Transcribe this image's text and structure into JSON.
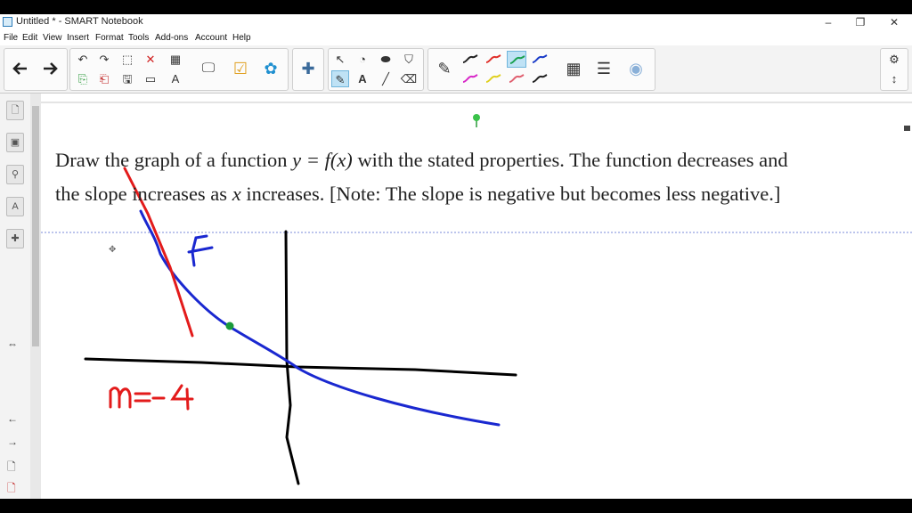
{
  "window": {
    "title": "Untitled * - SMART Notebook",
    "controls": {
      "minimize": "–",
      "maximize": "❐",
      "close": "✕"
    }
  },
  "menu": [
    "File",
    "Edit",
    "View",
    "Insert",
    "Format",
    "Tools",
    "Add-ons",
    "Account",
    "Help"
  ],
  "toolbar": {
    "icons": [
      "back-arrow",
      "forward-arrow",
      "undo",
      "redo",
      "page-add",
      "delete",
      "table",
      "screen-share",
      "response",
      "activity",
      "add-ons",
      "select",
      "shape",
      "fill",
      "pen",
      "text",
      "line",
      "eraser",
      "highlighter",
      "magic-pen",
      "properties",
      "settings"
    ],
    "pen_colors": [
      "#222222",
      "#e0302a",
      "#1aa150",
      "#1a3cc8",
      "#d828c8",
      "#e0d020",
      "#e06070",
      "#222222"
    ],
    "selected_pen_index": 2
  },
  "problem": {
    "line1_a": "Draw the graph of a function ",
    "line1_eq": "y = f(x)",
    "line1_b": " with the stated properties. The function decreases and",
    "line2_a": "the slope increases as ",
    "line2_x": "x",
    "line2_b": " increases. [Note: The slope is negative but becomes less negative.]"
  },
  "annotations": {
    "function_label": "f",
    "slope_label": "m=-4"
  },
  "colors": {
    "axis": "#000000",
    "curve": "#1a28d0",
    "tangent": "#e31b1b",
    "point": "#1a9a3a"
  }
}
